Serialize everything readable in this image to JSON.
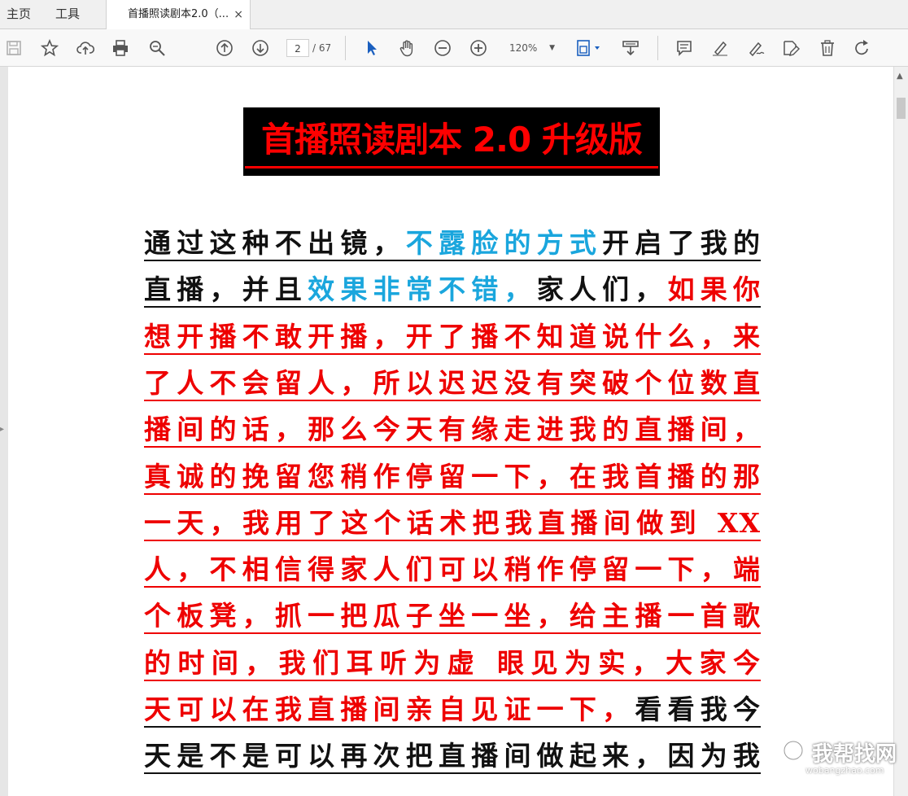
{
  "tabs": {
    "home": "主页",
    "tools": "工具",
    "document": "首播照读剧本2.0（...",
    "close_glyph": "×"
  },
  "toolbar": {
    "page_current": "2",
    "page_total": "/ 67",
    "zoom": "120%",
    "icons": [
      "save-icon",
      "star-icon",
      "cloud-upload-icon",
      "print-icon",
      "zoom-search-icon",
      "page-up-icon",
      "page-down-icon",
      "select-arrow-icon",
      "hand-icon",
      "zoom-out-icon",
      "zoom-in-icon",
      "fit-page-icon",
      "scroll-mode-icon",
      "comment-icon",
      "highlight-icon",
      "sign-icon",
      "edit-pdf-icon",
      "delete-icon",
      "rotate-icon"
    ]
  },
  "document": {
    "title": "首播照读剧本 2.0 升级版",
    "lines": [
      [
        {
          "t": "通过这种不出镜，",
          "c": "blk"
        },
        {
          "t": "不露脸的方式",
          "c": "blu"
        },
        {
          "t": "开启了我的",
          "c": "blk"
        }
      ],
      [
        {
          "t": "直播，并且",
          "c": "blk"
        },
        {
          "t": "效果非常不错，",
          "c": "blu"
        },
        {
          "t": "家人们，",
          "c": "blk"
        },
        {
          "t": "如果你",
          "c": "red"
        }
      ],
      [
        {
          "t": "想开播不敢开播，开了播不知道说什么，来",
          "c": "red"
        }
      ],
      [
        {
          "t": "了人不会留人，所以迟迟没有突破个位数直",
          "c": "red"
        }
      ],
      [
        {
          "t": "播间的话，那么今天有缘走进我的直播间，",
          "c": "red"
        }
      ],
      [
        {
          "t": "真诚的挽留您稍作停留一下，在我首播的那",
          "c": "red"
        }
      ],
      [
        {
          "t": "一天，我用了这个话术把我直播间做到 XX",
          "c": "red"
        }
      ],
      [
        {
          "t": "人，不相信得家人们可以稍作停留一下，端",
          "c": "red"
        }
      ],
      [
        {
          "t": "个板凳，抓一把瓜子坐一坐，给主播一首歌",
          "c": "red"
        }
      ],
      [
        {
          "t": "的时间，我们耳听为虚 眼见为实，大家今",
          "c": "red"
        }
      ],
      [
        {
          "t": "天可以在我直播间亲自见证一下，",
          "c": "red"
        },
        {
          "t": "看看我今",
          "c": "blk"
        }
      ],
      [
        {
          "t": "天是不是可以再次把直播间做起来，因为我",
          "c": "blk"
        }
      ]
    ],
    "line_underline": [
      "blk",
      "blk",
      "red",
      "red",
      "red",
      "red",
      "red",
      "red",
      "red",
      "red",
      "blk",
      "blk"
    ]
  },
  "watermark": {
    "text": "我帮找网",
    "url": "wobangzhao.com"
  },
  "colors": {
    "red": "#ee0000",
    "blue": "#1aa6dd",
    "black": "#111111",
    "title_bg": "#000000",
    "title_fg": "#ff0000"
  }
}
